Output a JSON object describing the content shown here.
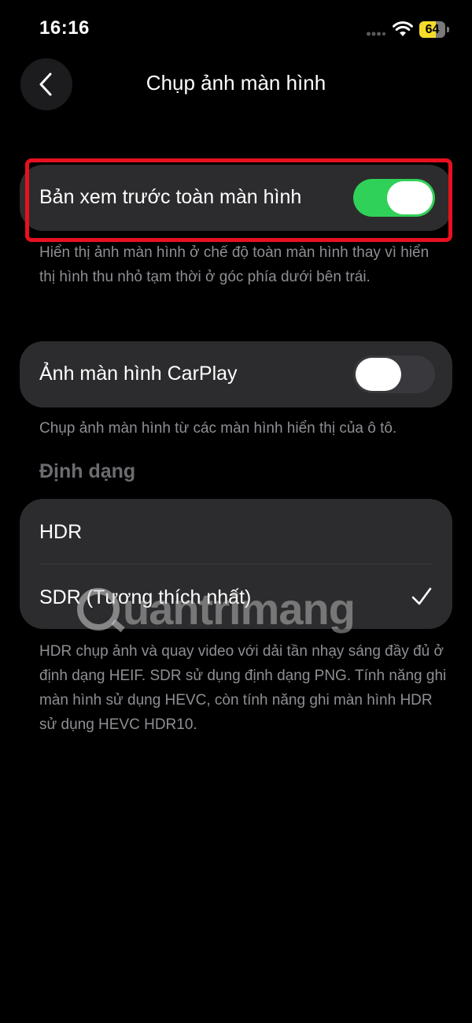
{
  "status_bar": {
    "time": "16:16",
    "battery_level": "64",
    "battery_fraction": 0.64,
    "battery_color": "#f5dc2b"
  },
  "header": {
    "back_icon": "chevron-left-icon",
    "title": "Chụp ảnh màn hình"
  },
  "fullscreen_preview": {
    "label": "Bản xem trước toàn màn hình",
    "enabled": true,
    "description": "Hiển thị ảnh màn hình ở chế độ toàn màn hình thay vì hiển thị hình thu nhỏ tạm thời ở góc phía dưới bên trái."
  },
  "carplay": {
    "label": "Ảnh màn hình CarPlay",
    "enabled": false,
    "description": "Chụp ảnh màn hình từ các màn hình hiển thị của ô tô."
  },
  "format": {
    "header": "Định dạng",
    "options": [
      {
        "label": "HDR",
        "selected": false
      },
      {
        "label": "SDR (Tương thích nhất)",
        "selected": true
      }
    ],
    "description": "HDR chụp ảnh và quay video với dải tần nhạy sáng đầy đủ ở định dạng HEIF. SDR sử dụng định dạng PNG. Tính năng ghi màn hình sử dụng HEVC, còn tính năng ghi màn hình HDR sử dụng HEVC HDR10."
  },
  "watermark": {
    "text": "uantrimang"
  },
  "colors": {
    "toggle_on": "#30d158",
    "card_bg": "#2c2c2e",
    "highlight": "#e8101f"
  }
}
